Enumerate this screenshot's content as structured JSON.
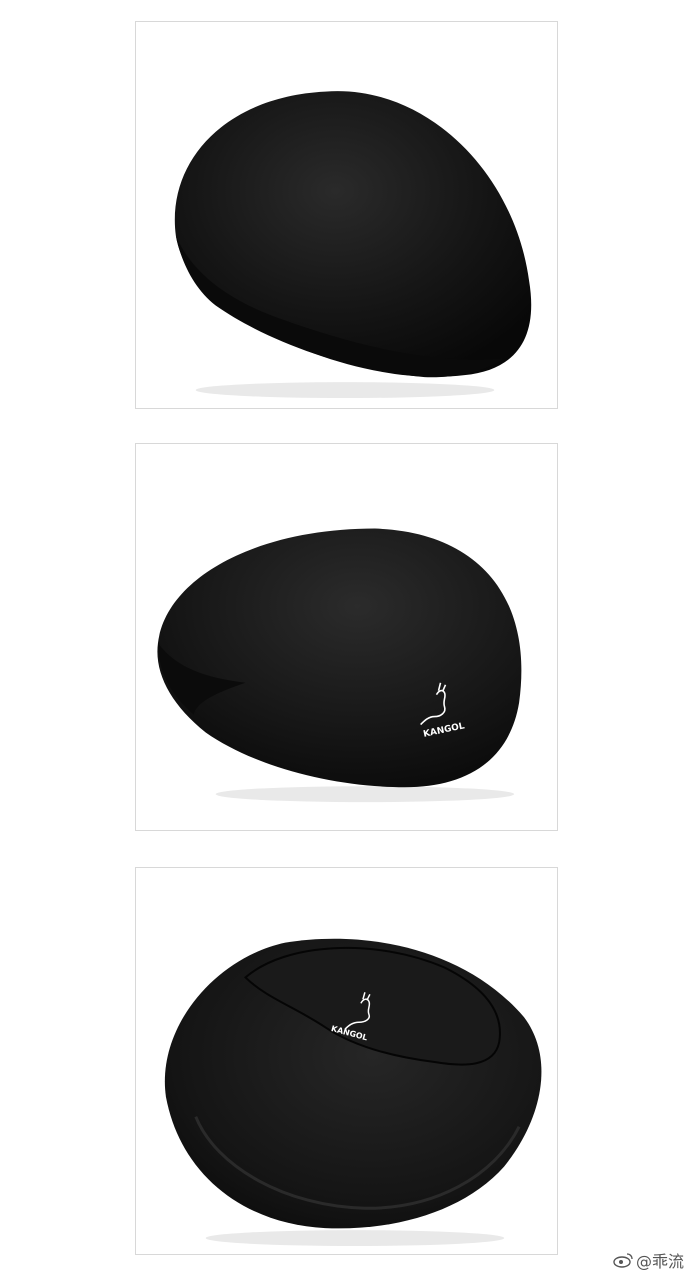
{
  "photos": [
    {
      "subject": "black flat cap, top view"
    },
    {
      "subject": "black flat cap, side view",
      "logo_text": "KANGOL"
    },
    {
      "subject": "black flat cap, underside view",
      "logo_text": "KANGOL"
    }
  ],
  "watermark": {
    "icon": "weibo-icon",
    "text": "@乖流"
  },
  "colors": {
    "cap": "#141414",
    "panel_border": "#d8d8d8",
    "background": "#ffffff"
  }
}
